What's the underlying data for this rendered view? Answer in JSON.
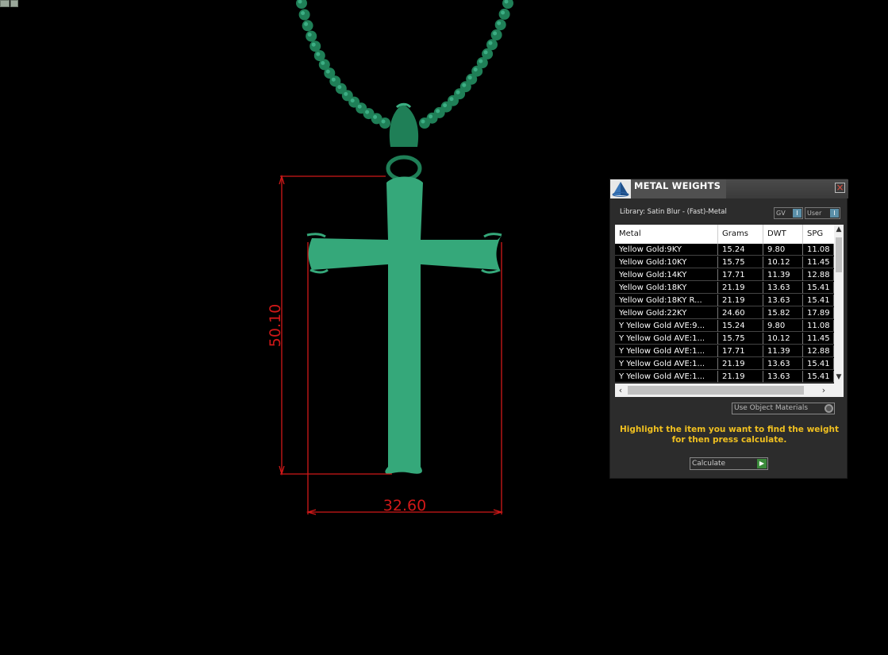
{
  "colors": {
    "pendant": "#35a87a",
    "chain": "#1f7f57",
    "dimension": "#d01818",
    "hint": "#f0c020"
  },
  "dimensions": {
    "height_label": "50.10",
    "width_label": "32.60"
  },
  "panel": {
    "title": "METAL WEIGHTS",
    "close_icon": "close-icon",
    "library": "Library: Satin Blur - (Fast)-Metal",
    "toggle_gv": "GV",
    "toggle_user": "User",
    "columns": [
      "Metal",
      "Grams",
      "DWT",
      "SPG"
    ],
    "rows": [
      [
        "Yellow Gold:9KY",
        "15.24",
        "9.80",
        "11.08"
      ],
      [
        "Yellow Gold:10KY",
        "15.75",
        "10.12",
        "11.45"
      ],
      [
        "Yellow Gold:14KY",
        "17.71",
        "11.39",
        "12.88"
      ],
      [
        "Yellow Gold:18KY",
        "21.19",
        "13.63",
        "15.41"
      ],
      [
        "Yellow Gold:18KY R...",
        "21.19",
        "13.63",
        "15.41"
      ],
      [
        "Yellow Gold:22KY",
        "24.60",
        "15.82",
        "17.89"
      ],
      [
        "Y Yellow Gold AVE:9...",
        "15.24",
        "9.80",
        "11.08"
      ],
      [
        "Y Yellow Gold AVE:1...",
        "15.75",
        "10.12",
        "11.45"
      ],
      [
        "Y Yellow Gold AVE:1...",
        "17.71",
        "11.39",
        "12.88"
      ],
      [
        "Y Yellow Gold AVE:1...",
        "21.19",
        "13.63",
        "15.41"
      ],
      [
        "Y Yellow Gold AVE:1...",
        "21.19",
        "13.63",
        "15.41"
      ]
    ],
    "use_object_materials": "Use Object Materials",
    "hint": "Highlight the item you want to find the weight for then press calculate.",
    "calculate": "Calculate"
  }
}
